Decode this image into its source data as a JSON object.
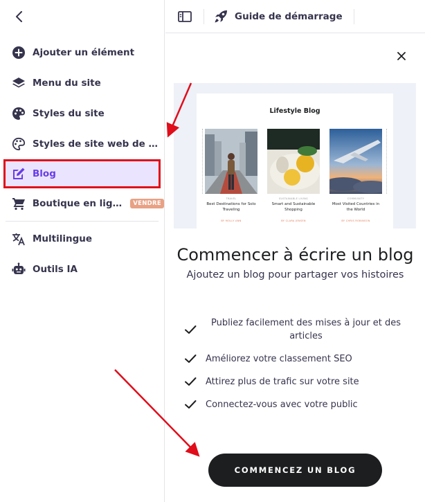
{
  "sidebar": {
    "items": [
      {
        "label": "Ajouter un élément",
        "icon": "plus-circle-icon"
      },
      {
        "label": "Menu du site",
        "icon": "layers-icon"
      },
      {
        "label": "Styles du site",
        "icon": "palette-icon"
      },
      {
        "label": "Styles de site web de design",
        "icon": "palette-outline-icon"
      },
      {
        "label": "Blog",
        "icon": "edit-icon",
        "active": true
      },
      {
        "label": "Boutique en ligne",
        "icon": "cart-icon",
        "badge": "VENDRE"
      },
      {
        "label": "Multilingue",
        "icon": "translate-icon"
      },
      {
        "label": "Outils IA",
        "icon": "robot-icon"
      }
    ]
  },
  "topbar": {
    "guide_label": "Guide de démarrage"
  },
  "preview": {
    "title": "Lifestyle Blog",
    "posts": [
      {
        "category": "TRAVEL",
        "title": "Best Destinations for Solo Traveling",
        "author": "BY MOLLY ANN"
      },
      {
        "category": "SUSTAINABLE LIVING",
        "title": "Smart and Sustainable Shopping",
        "author": "BY CLARA JENSEN"
      },
      {
        "category": "COMMUNITY",
        "title": "Most Visited Countries in the World",
        "author": "BY CHRIS ROBINSON"
      }
    ]
  },
  "panel": {
    "heading": "Commencer à écrire un blog",
    "subheading": "Ajoutez un blog pour partager vos histoires",
    "features": [
      "Publiez facilement des mises à jour et des articles",
      "Améliorez votre classement SEO",
      "Attirez plus de trafic sur votre site",
      "Connectez-vous avec votre public"
    ],
    "cta_label": "COMMENCEZ UN BLOG"
  },
  "colors": {
    "accent": "#673de6",
    "active_bg": "#ebe4ff",
    "highlight_border": "#e00d1a",
    "badge_bg": "#e8a184",
    "cta_bg": "#1d1e20",
    "annotation_arrow": "#e00d1a"
  }
}
